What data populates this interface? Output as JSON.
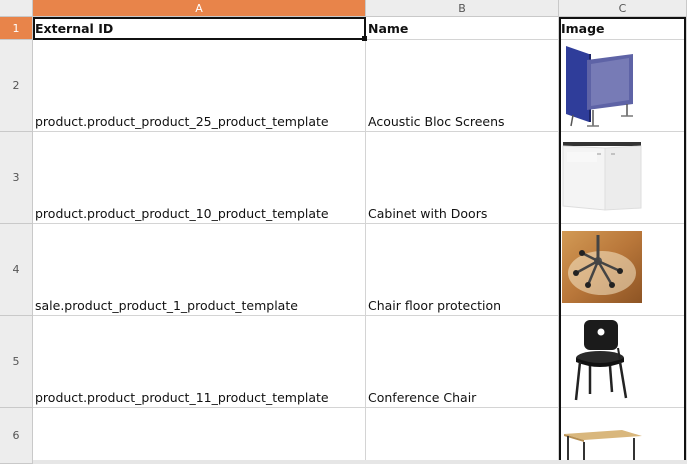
{
  "columns": [
    "A",
    "B",
    "C"
  ],
  "rows": [
    "1",
    "2",
    "3",
    "4",
    "5",
    "6"
  ],
  "headers": {
    "external_id": "External ID",
    "name": "Name",
    "image": "Image"
  },
  "records": [
    {
      "external_id": "product.product_product_25_product_template",
      "name": "Acoustic Bloc Screens",
      "image_icon": "acoustic-screen-image"
    },
    {
      "external_id": "product.product_product_10_product_template",
      "name": "Cabinet with Doors",
      "image_icon": "cabinet-image"
    },
    {
      "external_id": "sale.product_product_1_product_template",
      "name": "Chair floor protection",
      "image_icon": "chair-floor-protection-image"
    },
    {
      "external_id": "product.product_product_11_product_template",
      "name": "Conference Chair",
      "image_icon": "conference-chair-image"
    },
    {
      "external_id": "",
      "name": "",
      "image_icon": "desk-image"
    }
  ],
  "colors": {
    "active_header": "#e8844a",
    "header_bg": "#ededed",
    "grid_line": "#d4d4d4"
  }
}
